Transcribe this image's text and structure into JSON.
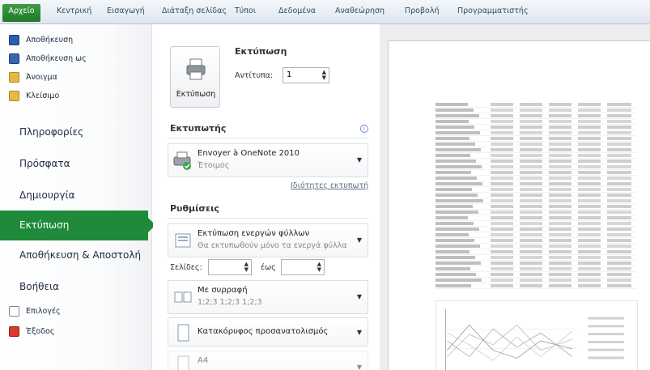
{
  "ribbon": {
    "tabs": [
      "Αρχείο",
      "Κεντρική",
      "Εισαγωγή",
      "Διάταξη σελίδας",
      "Τύποι",
      "Δεδομένα",
      "Αναθεώρηση",
      "Προβολή",
      "Προγραμματιστής"
    ],
    "active": "Αρχείο"
  },
  "sidebar": {
    "small_items": [
      "Αποθήκευση",
      "Αποθήκευση ως",
      "Άνοιγμα",
      "Κλείσιμο"
    ],
    "big_items": [
      "Πληροφορίες",
      "Πρόσφατα",
      "Δημιουργία",
      "Εκτύπωση",
      "Αποθήκευση & Αποστολή",
      "Βοήθεια"
    ],
    "selected": "Εκτύπωση",
    "bottom_items": [
      "Επιλογές",
      "Έξοδος"
    ]
  },
  "print": {
    "header": "Εκτύπωση",
    "button_label": "Εκτύπωση",
    "copies_label": "Αντίτυπα:",
    "copies_value": "1"
  },
  "printer": {
    "header": "Εκτυπωτής",
    "name": "Envoyer à OneNote 2010",
    "status": "Έτοιμος",
    "properties_link": "Ιδιότητες εκτυπωτή"
  },
  "settings": {
    "header": "Ρυθμίσεις",
    "active_sheets_title": "Εκτύπωση ενεργών φύλλων",
    "active_sheets_desc": "Θα εκτυπωθούν μόνο τα ενεργά φύλλα",
    "pages_label": "Σελίδες:",
    "pages_from": "",
    "to_label": "έως",
    "pages_to": "",
    "collate_title": "Με συρραφή",
    "collate_desc": "1;2;3   1;2;3   1;2;3",
    "orientation": "Κατακόρυφος προσανατολισμός",
    "paper": "A4"
  },
  "colors": {
    "accent": "#1f8a3a",
    "ribbon_bg": "#e7edf5"
  },
  "icons": {
    "save": "save-icon",
    "save_as": "save-as-icon",
    "open": "folder-icon",
    "close": "close-folder-icon",
    "options": "options-icon",
    "exit": "exit-icon",
    "printer": "printer-icon",
    "onenote": "onenote-printer-icon"
  }
}
